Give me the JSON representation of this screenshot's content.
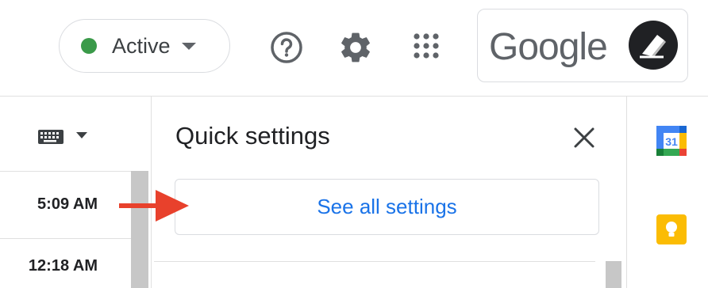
{
  "header": {
    "status": {
      "label": "Active",
      "dot_color": "#3a9a49"
    },
    "account": {
      "brand": "Google"
    }
  },
  "mail_list": {
    "rows": [
      {
        "time": "5:09 AM"
      },
      {
        "time": "12:18 AM"
      }
    ]
  },
  "quick_settings": {
    "title": "Quick settings",
    "see_all_label": "See all settings",
    "accent_color": "#1a73e8"
  },
  "side_apps": {
    "calendar_day": "31"
  },
  "annotation": {
    "arrow_color": "#e8412c"
  }
}
